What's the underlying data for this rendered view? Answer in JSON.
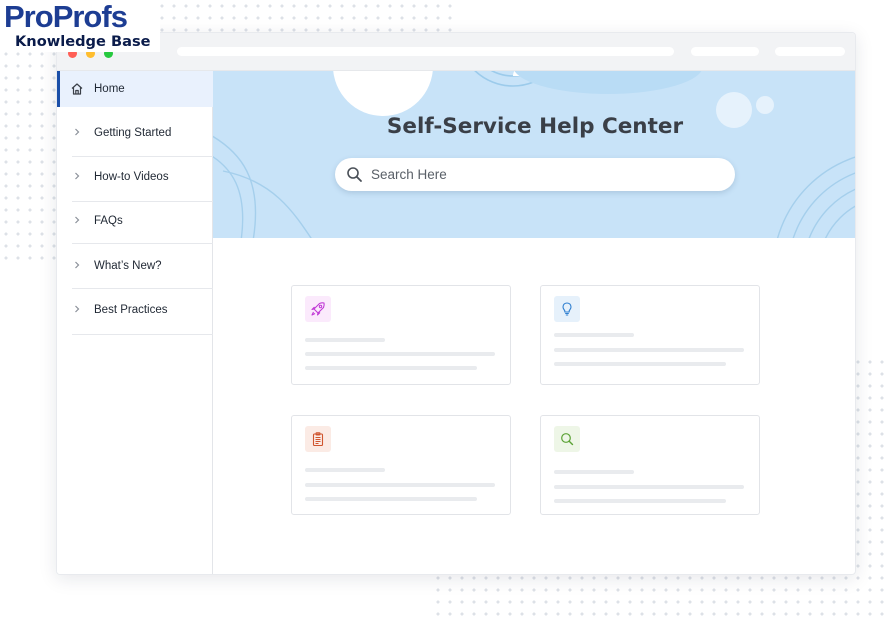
{
  "logo": {
    "brand_part1": "Pro",
    "brand_part2": "Profs",
    "product": "Knowledge Base"
  },
  "window": {
    "controls": [
      "close",
      "minimize",
      "maximize"
    ]
  },
  "sidebar": {
    "items": [
      {
        "label": "Home",
        "icon": "home-icon",
        "active": true
      },
      {
        "label": "Getting Started",
        "icon": "chevron-right-icon"
      },
      {
        "label": "How-to Videos",
        "icon": "chevron-right-icon"
      },
      {
        "label": "FAQs",
        "icon": "chevron-right-icon"
      },
      {
        "label": "What’s New?",
        "icon": "chevron-right-icon"
      },
      {
        "label": "Best Practices",
        "icon": "chevron-right-icon"
      }
    ]
  },
  "hero": {
    "title": "Self-Service Help Center",
    "search": {
      "placeholder": "Search Here",
      "value": ""
    }
  },
  "cards": [
    {
      "icon": "rocket-icon",
      "accent": "#c13ad6",
      "tint": "#fbeafc"
    },
    {
      "icon": "lightbulb-icon",
      "accent": "#2f7fd0",
      "tint": "#e6f1fb"
    },
    {
      "icon": "clipboard-icon",
      "accent": "#d0552f",
      "tint": "#fbebe5"
    },
    {
      "icon": "search-icon",
      "accent": "#5ba235",
      "tint": "#eef6e7"
    }
  ],
  "colors": {
    "hero_bg": "#c8e3f8",
    "active_nav_bg": "#e9f1fd",
    "brand_blue": "#1d3d93"
  }
}
